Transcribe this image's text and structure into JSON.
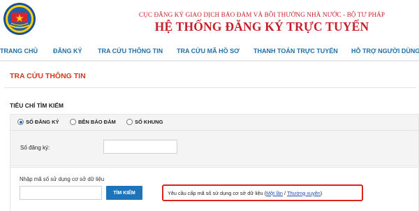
{
  "header": {
    "agency": "CỤC ĐĂNG KÝ GIAO DỊCH BẢO ĐẢM VÀ BỒI THƯỜNG NHÀ NƯỚC - BỘ TƯ PHÁP",
    "title": "HỆ THỐNG ĐĂNG KÝ TRỰC TUYẾN",
    "logo_icon": "ministry-emblem-icon"
  },
  "nav": {
    "items": [
      {
        "label": "TRANG CHỦ"
      },
      {
        "label": "ĐĂNG KÝ"
      },
      {
        "label": "TRA CỨU THÔNG TIN"
      },
      {
        "label": "TRA CỨU MÃ HỒ SƠ"
      },
      {
        "label": "THANH TOÁN TRỰC TUYẾN"
      },
      {
        "label": "HỖ TRỢ NGƯỜI DÙNG"
      }
    ]
  },
  "page": {
    "title": "TRA CỨU THÔNG TIN",
    "criteria_title": "TIÊU CHÍ TÌM KIẾM"
  },
  "search": {
    "options": [
      {
        "label": "SỐ ĐĂNG KÝ",
        "selected": true
      },
      {
        "label": "BÊN BẢO ĐẢM",
        "selected": false
      },
      {
        "label": "SỐ KHUNG",
        "selected": false
      }
    ],
    "field_label": "Số đăng ký:",
    "field_value": "",
    "code_label": "Nhập mã số sử dụng cơ sở dữ liệu",
    "code_value": "",
    "button_label": "TÌM KIẾM"
  },
  "request": {
    "prefix": "Yêu cầu cấp mã số sử dụng cơ sở dữ liệu (",
    "once": "Một lần",
    "separator": " / ",
    "regular": "Thường xuyên",
    "suffix": ")"
  },
  "colors": {
    "brand_red": "#c8202a",
    "nav_blue": "#1f6fa8",
    "button_blue": "#1e74b8",
    "highlight_red": "#d9251c"
  }
}
